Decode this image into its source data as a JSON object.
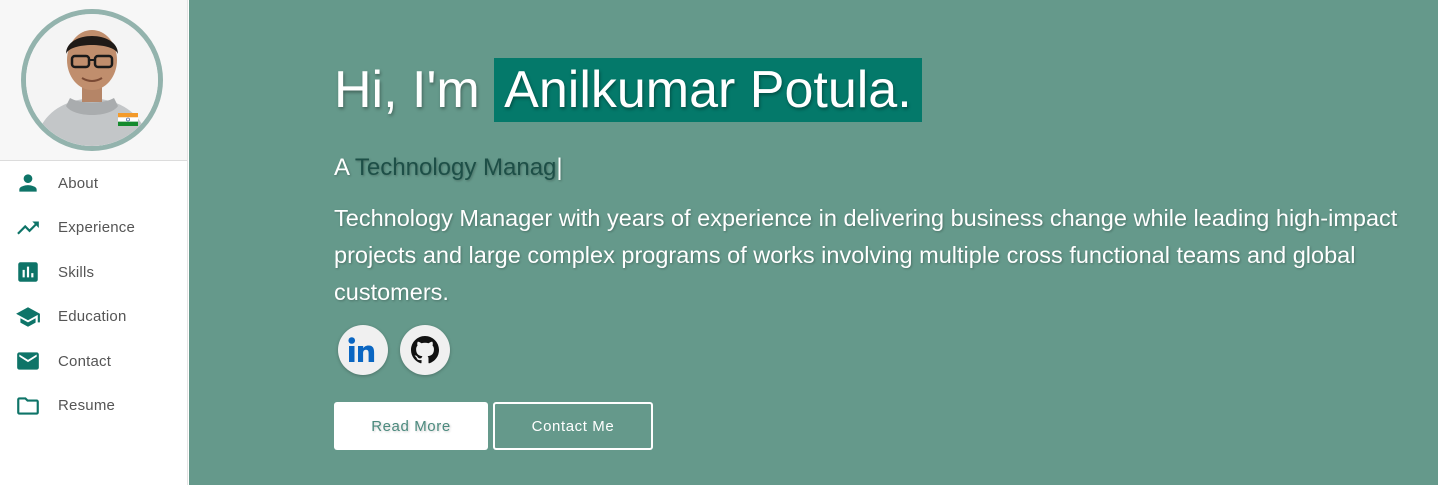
{
  "sidebar": {
    "items": [
      {
        "label": "About",
        "icon": "person-icon"
      },
      {
        "label": "Experience",
        "icon": "trending-up-icon"
      },
      {
        "label": "Skills",
        "icon": "bar-chart-icon"
      },
      {
        "label": "Education",
        "icon": "graduation-cap-icon"
      },
      {
        "label": "Contact",
        "icon": "mail-icon"
      },
      {
        "label": "Resume",
        "icon": "folder-icon"
      }
    ]
  },
  "hero": {
    "greeting_prefix": "Hi, I'm",
    "name": "Anilkumar Potula.",
    "tagline_prefix": "A",
    "tagline_typed": "Technology Manag",
    "tagline_cursor": "|",
    "description": "Technology Manager with years of experience in delivering business change while leading high-impact projects and large complex programs of works involving multiple cross functional teams and global customers.",
    "social": [
      {
        "name": "linkedin",
        "icon": "linkedin-icon"
      },
      {
        "name": "github",
        "icon": "github-icon"
      }
    ],
    "buttons": {
      "read_more": "Read More",
      "contact_me": "Contact Me"
    }
  },
  "colors": {
    "accent": "#0e7468",
    "hero_bg": "#65998b",
    "name_highlight": "#04796a",
    "avatar_border": "#93b3ad"
  }
}
